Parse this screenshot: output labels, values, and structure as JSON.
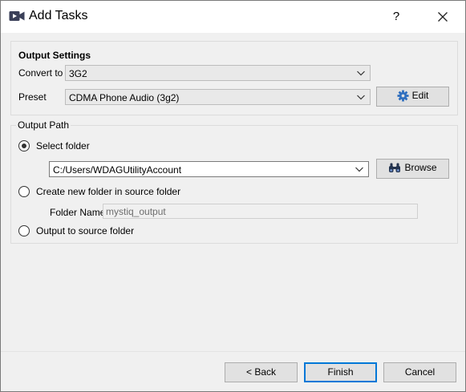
{
  "window": {
    "title": "Add Tasks",
    "help_glyph": "?",
    "close_glyph": "×",
    "app_icon": "video-camera-icon"
  },
  "output_settings": {
    "title": "Output Settings",
    "convert_to_label": "Convert to",
    "convert_to_value": "3G2",
    "preset_label": "Preset",
    "preset_value": "CDMA Phone Audio (3g2)",
    "edit_button": "Edit",
    "edit_icon": "gear-icon",
    "edit_icon_color": "#2f6fbf"
  },
  "output_path": {
    "title": "Output Path",
    "select_folder_label": "Select folder",
    "select_folder_checked": true,
    "folder_path": "C:/Users/WDAGUtilityAccount",
    "browse_button": "Browse",
    "browse_icon": "binoculars-icon",
    "create_new_folder_label": "Create new folder in source folder",
    "folder_name_label": "Folder Name",
    "folder_name_value": "mystiq_output",
    "output_to_source_label": "Output to source folder"
  },
  "footer": {
    "back_button": "< Back",
    "finish_button": "Finish",
    "cancel_button": "Cancel",
    "focus_color": "#0078d7"
  }
}
